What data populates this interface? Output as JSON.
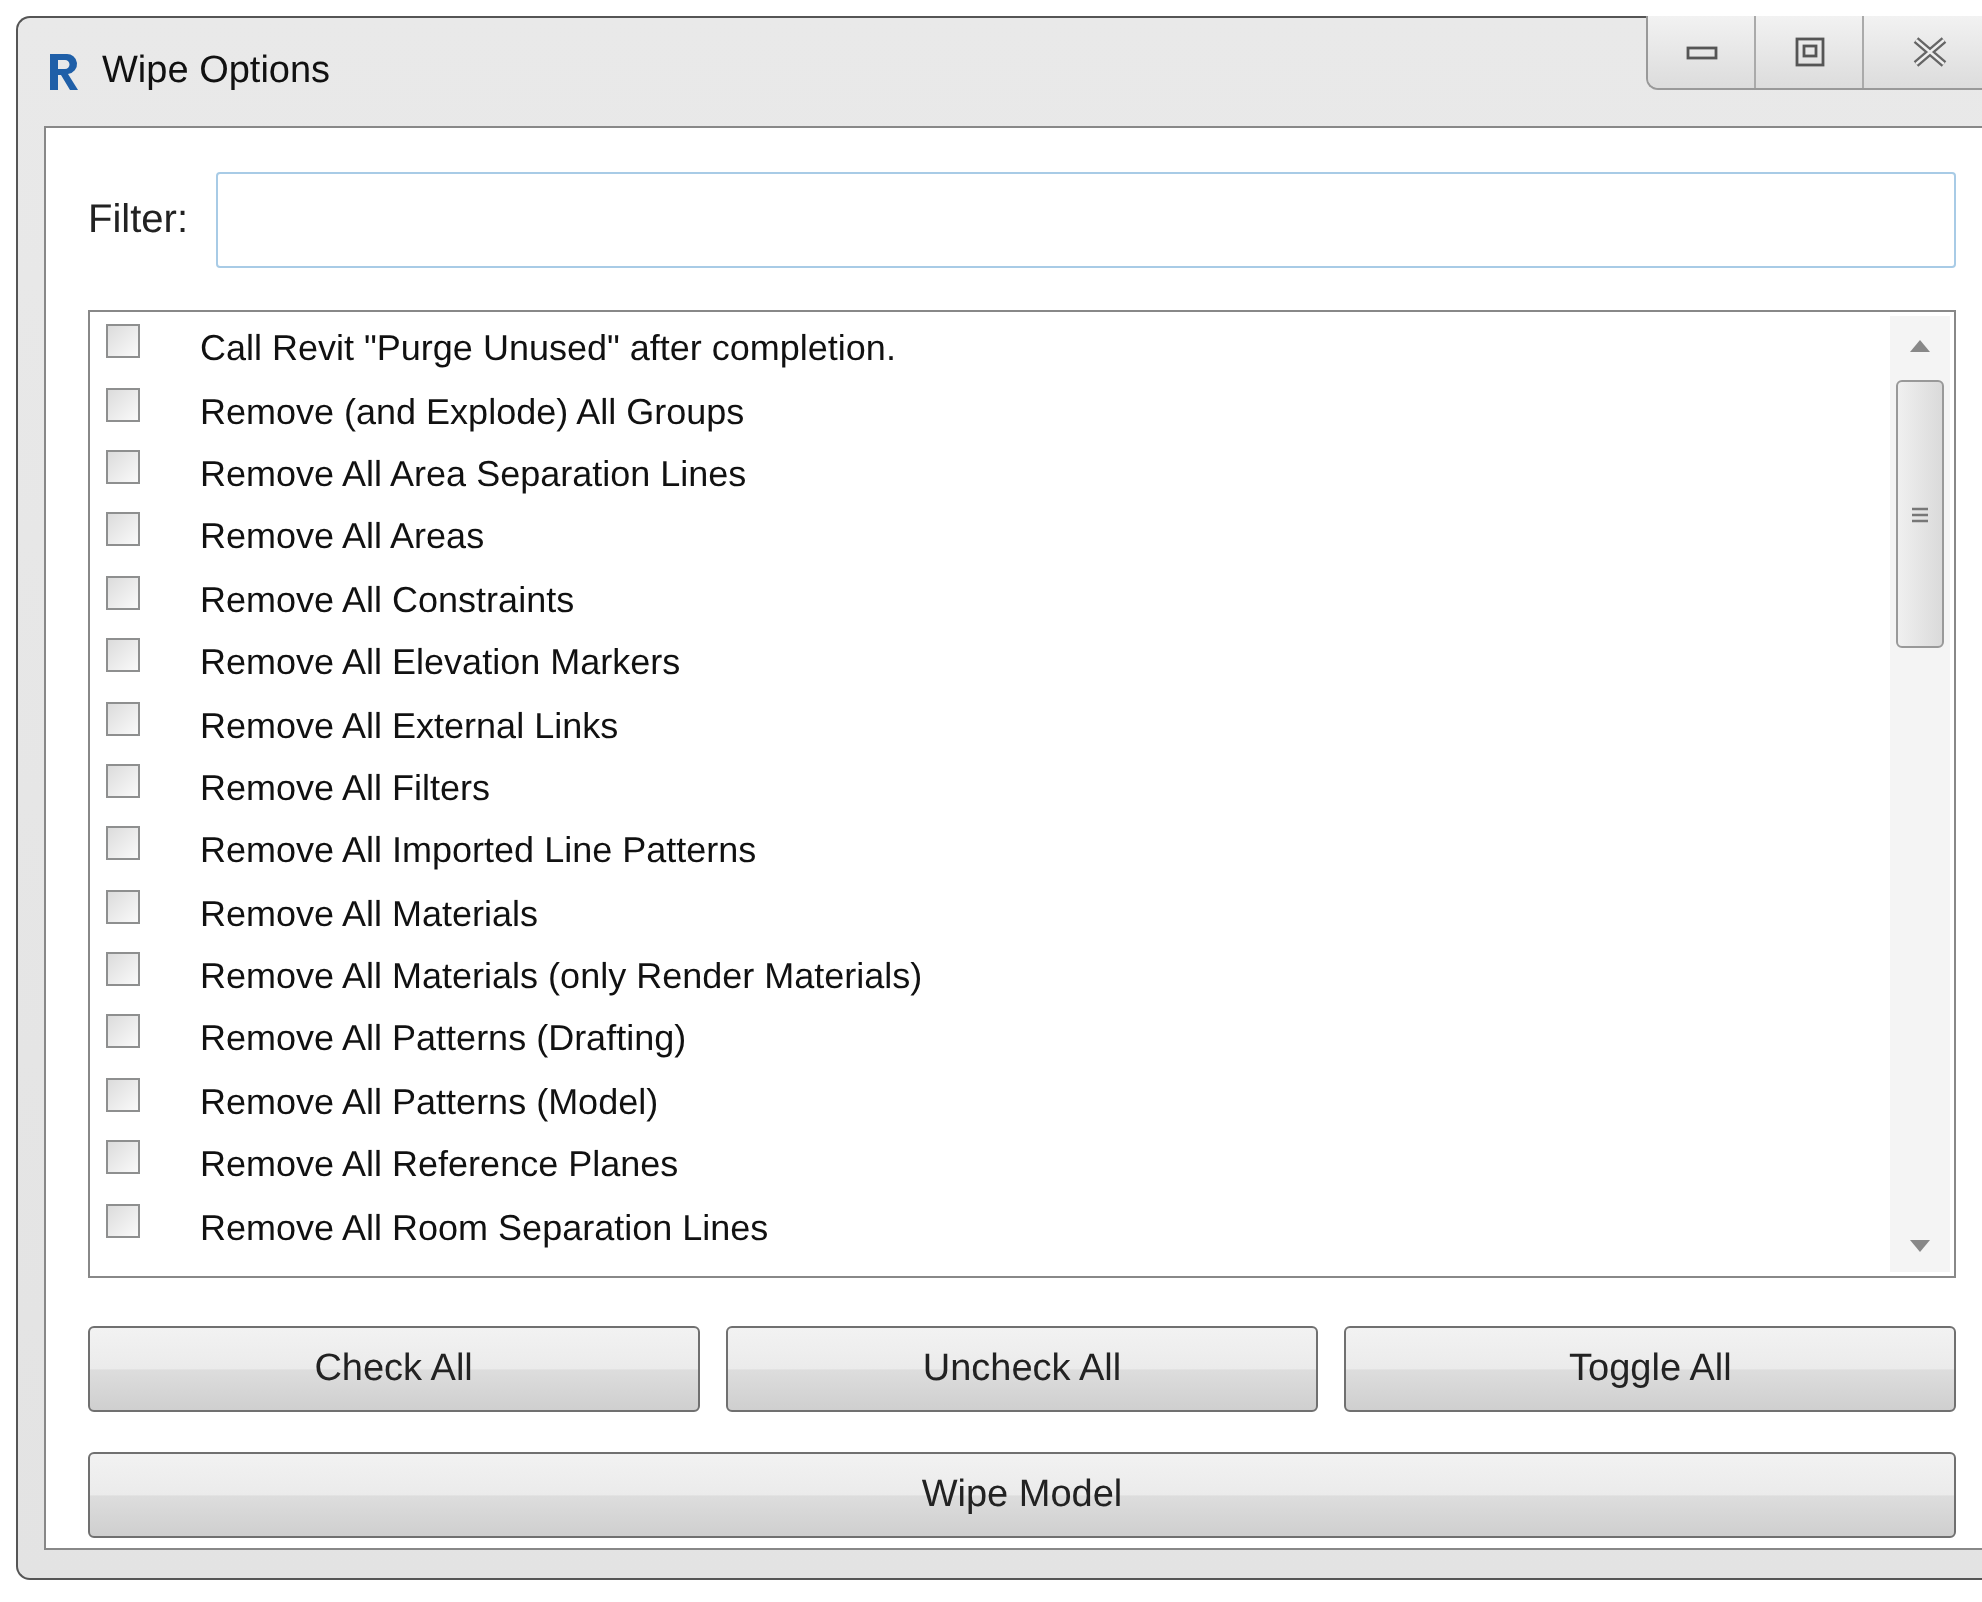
{
  "window": {
    "title": "Wipe Options"
  },
  "filter": {
    "label": "Filter:"
  },
  "options": [
    {
      "label": "Call Revit \"Purge Unused\" after completion.",
      "checked": false
    },
    {
      "label": "Remove (and Explode) All Groups",
      "checked": false
    },
    {
      "label": "Remove All Area Separation Lines",
      "checked": false
    },
    {
      "label": "Remove All Areas",
      "checked": false
    },
    {
      "label": "Remove All Constraints",
      "checked": false
    },
    {
      "label": "Remove All Elevation Markers",
      "checked": false
    },
    {
      "label": "Remove All External Links",
      "checked": false
    },
    {
      "label": "Remove All Filters",
      "checked": false
    },
    {
      "label": "Remove All Imported Line Patterns",
      "checked": false
    },
    {
      "label": "Remove All Materials",
      "checked": false
    },
    {
      "label": "Remove All Materials (only Render Materials)",
      "checked": false
    },
    {
      "label": "Remove All Patterns (Drafting)",
      "checked": false
    },
    {
      "label": "Remove All Patterns (Model)",
      "checked": false
    },
    {
      "label": "Remove All Reference Planes",
      "checked": false
    },
    {
      "label": "Remove All Room Separation Lines",
      "checked": false
    }
  ],
  "buttons": [
    "Check All",
    "Uncheck All",
    "Toggle All"
  ],
  "primary_button": "Wipe Model"
}
